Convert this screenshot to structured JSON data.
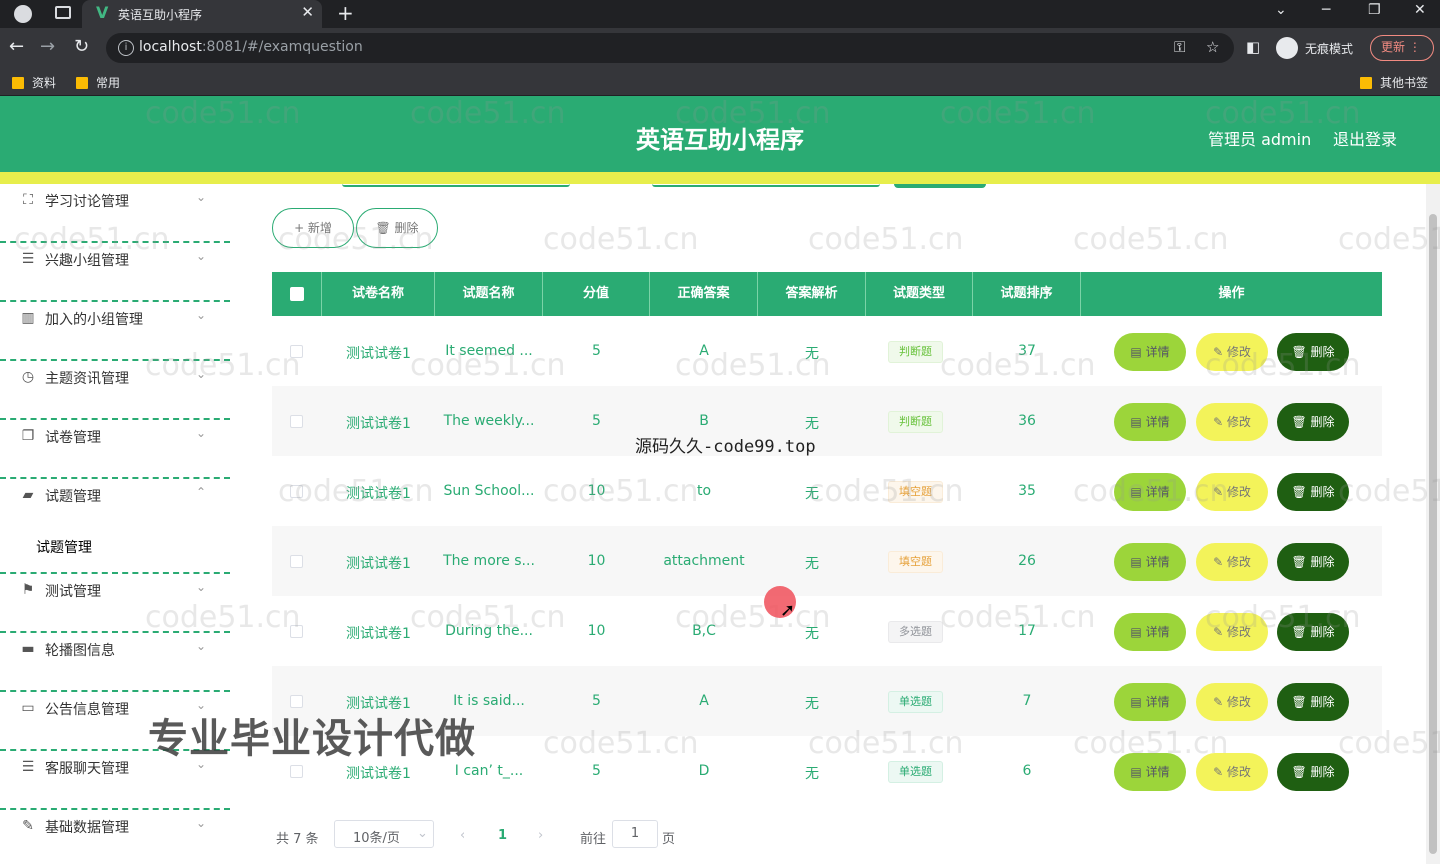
{
  "browser": {
    "tab_title": "英语互助小程序",
    "tab_logo": "V",
    "url_host": "localhost",
    "url_path": ":8081/#/examquestion",
    "incognito_label": "无痕模式",
    "update_label": "更新",
    "bookmarks": [
      "资料",
      "常用"
    ],
    "other_bookmarks": "其他书签"
  },
  "header": {
    "title": "英语互助小程序",
    "admin": "管理员 admin",
    "logout": "退出登录"
  },
  "sidebar": {
    "items": [
      {
        "label": "学习讨论管理",
        "icon": "expand-icon"
      },
      {
        "label": "兴趣小组管理",
        "icon": "list-icon"
      },
      {
        "label": "加入的小组管理",
        "icon": "bar-chart-icon"
      },
      {
        "label": "主题资讯管理",
        "icon": "clock-icon"
      },
      {
        "label": "试卷管理",
        "icon": "copy-icon"
      },
      {
        "label": "试题管理",
        "icon": "chat-icon"
      },
      {
        "label": "测试管理",
        "icon": "flag-icon"
      },
      {
        "label": "轮播图信息",
        "icon": "monitor-icon"
      },
      {
        "label": "公告信息管理",
        "icon": "notice-icon"
      },
      {
        "label": "客服聊天管理",
        "icon": "menu-icon"
      },
      {
        "label": "基础数据管理",
        "icon": "edit-icon"
      }
    ],
    "submenu_label": "试题管理"
  },
  "toolbar": {
    "add_label": "+ 新增",
    "delete_label": "🗑 删除"
  },
  "table": {
    "headers": [
      "试卷名称",
      "试题名称",
      "分值",
      "正确答案",
      "答案解析",
      "试题类型",
      "试题排序",
      "操作"
    ],
    "rows": [
      {
        "paper": "测试试卷1",
        "question": "It seemed ...",
        "score": "5",
        "answer": "A",
        "analysis": "无",
        "type": "判断题",
        "order": "37"
      },
      {
        "paper": "测试试卷1",
        "question": "The weekly...",
        "score": "5",
        "answer": "B",
        "analysis": "无",
        "type": "判断题",
        "order": "36"
      },
      {
        "paper": "测试试卷1",
        "question": "Sun School...",
        "score": "10",
        "answer": "to",
        "analysis": "无",
        "type": "填空题",
        "order": "35"
      },
      {
        "paper": "测试试卷1",
        "question": "The more s...",
        "score": "10",
        "answer": "attachment",
        "analysis": "无",
        "type": "填空题",
        "order": "26"
      },
      {
        "paper": "测试试卷1",
        "question": "During the...",
        "score": "10",
        "answer": "B,C",
        "analysis": "无",
        "type": "多选题",
        "order": "17"
      },
      {
        "paper": "测试试卷1",
        "question": "It is said...",
        "score": "5",
        "answer": "A",
        "analysis": "无",
        "type": "单选题",
        "order": "7"
      },
      {
        "paper": "测试试卷1",
        "question": "I can’ t_...",
        "score": "5",
        "answer": "D",
        "analysis": "无",
        "type": "单选题",
        "order": "6"
      }
    ],
    "action_detail": "▤ 详情",
    "action_edit": "✎ 修改",
    "action_delete": "🗑 删除"
  },
  "pager": {
    "total": "共 7 条",
    "page_size": "10条/页",
    "current": "1",
    "goto_label": "前往",
    "goto_value": "1",
    "page_suffix": "页"
  },
  "overlays": {
    "source_watermark": "源码久久-code99.top",
    "thesis_ad": "专业毕业设计代做",
    "site_watermark": "code51.cn"
  },
  "colors": {
    "primary": "#2aab73",
    "strip": "#e7ee4c",
    "detail_btn": "#9cd53a",
    "edit_btn": "#f3f35a",
    "delete_btn": "#1f5f12"
  }
}
